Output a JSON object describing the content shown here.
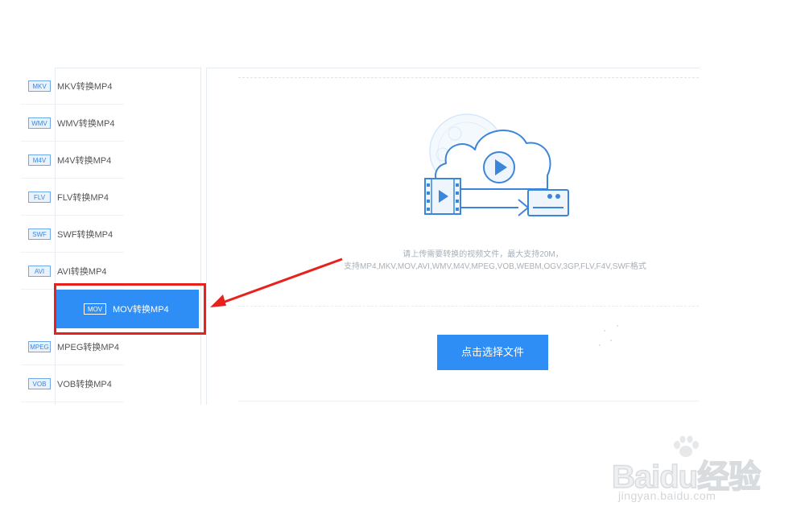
{
  "sidebar": {
    "items": [
      {
        "badge": "MKV",
        "label": "MKV转换MP4",
        "active": false
      },
      {
        "badge": "WMV",
        "label": "WMV转换MP4",
        "active": false
      },
      {
        "badge": "M4V",
        "label": "M4V转换MP4",
        "active": false
      },
      {
        "badge": "FLV",
        "label": "FLV转换MP4",
        "active": false
      },
      {
        "badge": "SWF",
        "label": "SWF转换MP4",
        "active": false
      },
      {
        "badge": "AVI",
        "label": "AVI转换MP4",
        "active": false
      },
      {
        "badge": "MOV",
        "label": "MOV转换MP4",
        "active": true
      },
      {
        "badge": "MPEG",
        "label": "MPEG转换MP4",
        "active": false
      },
      {
        "badge": "VOB",
        "label": "VOB转换MP4",
        "active": false
      }
    ]
  },
  "main": {
    "hint_line1": "请上传需要转换的视频文件，最大支持20M，",
    "hint_line2": "支持MP4,MKV,MOV,AVI,WMV,M4V,MPEG,VOB,WEBM,OGV,3GP,FLV,F4V,SWF格式",
    "upload_button": "点击选择文件"
  },
  "watermark": {
    "brand": "Baidu经验",
    "url": "jingyan.baidu.com"
  },
  "colors": {
    "accent": "#2f8ef5",
    "highlight": "#e8211c",
    "icon": "#3b86da"
  }
}
